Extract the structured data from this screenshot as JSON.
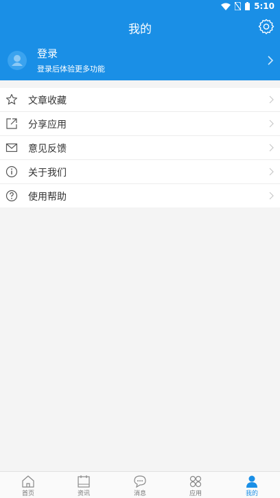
{
  "status_bar": {
    "time": "5:10"
  },
  "header": {
    "title": "我的",
    "settings_icon": "gear-icon"
  },
  "profile": {
    "name": "登录",
    "subtitle": "登录后体验更多功能",
    "avatar_icon": "user-icon"
  },
  "menu": {
    "items": [
      {
        "label": "文章收藏",
        "icon": "star-icon"
      },
      {
        "label": "分享应用",
        "icon": "share-icon"
      },
      {
        "label": "意见反馈",
        "icon": "mail-icon"
      },
      {
        "label": "关于我们",
        "icon": "info-icon"
      },
      {
        "label": "使用帮助",
        "icon": "help-icon"
      }
    ]
  },
  "tabbar": {
    "items": [
      {
        "label": "首页",
        "icon": "home-icon"
      },
      {
        "label": "资讯",
        "icon": "calendar-icon"
      },
      {
        "label": "消息",
        "icon": "chat-icon"
      },
      {
        "label": "应用",
        "icon": "apps-icon"
      },
      {
        "label": "我的",
        "icon": "user-icon"
      }
    ],
    "active": "我的"
  },
  "colors": {
    "accent": "#1a8fe6",
    "background": "#f4f4f4"
  }
}
